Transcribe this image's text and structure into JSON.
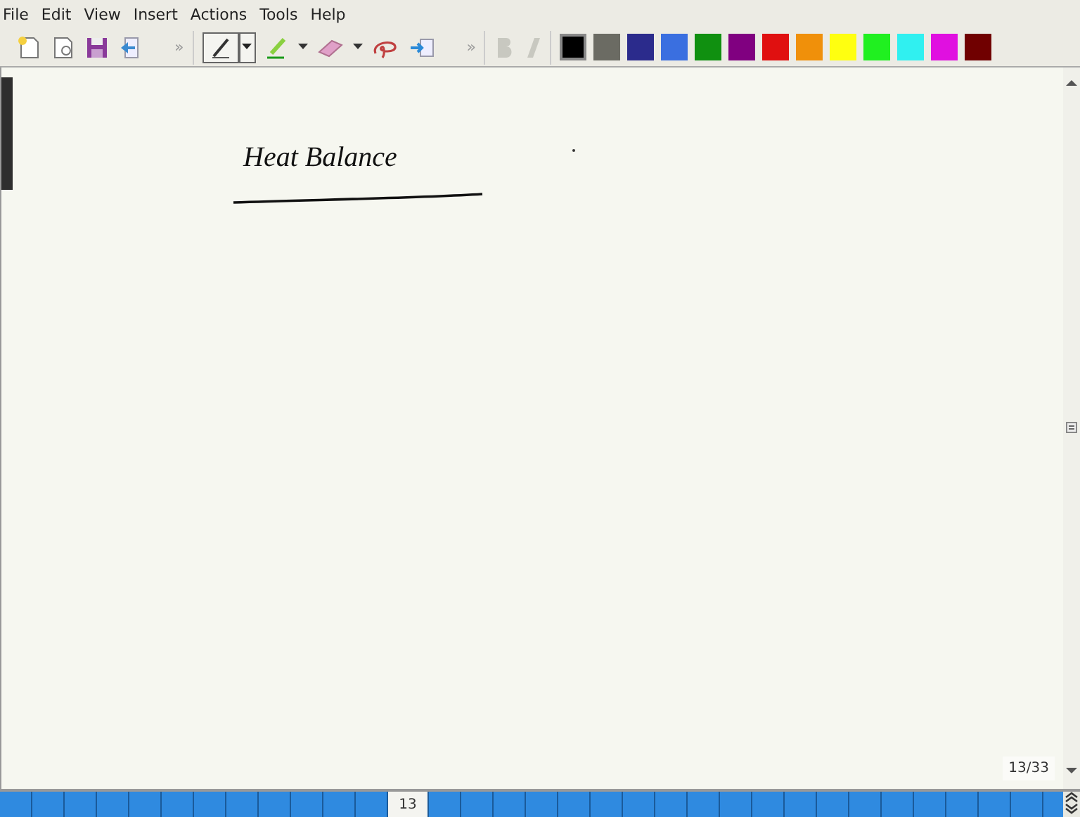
{
  "menu": [
    "File",
    "Edit",
    "View",
    "Insert",
    "Actions",
    "Tools",
    "Help"
  ],
  "toolbar": {
    "overflow_left": "»",
    "overflow_right": "»",
    "pen_selected": true,
    "bold_disabled": true,
    "italic_disabled": true
  },
  "palette": [
    {
      "color": "#000000",
      "selected": true
    },
    {
      "color": "#6b6b63",
      "selected": false
    },
    {
      "color": "#2b2b8c",
      "selected": false
    },
    {
      "color": "#3a6fe0",
      "selected": false
    },
    {
      "color": "#109010",
      "selected": false
    },
    {
      "color": "#800080",
      "selected": false
    },
    {
      "color": "#e01010",
      "selected": false
    },
    {
      "color": "#f0900a",
      "selected": false
    },
    {
      "color": "#ffff10",
      "selected": false
    },
    {
      "color": "#20f020",
      "selected": false
    },
    {
      "color": "#30f0f0",
      "selected": false
    },
    {
      "color": "#e010e0",
      "selected": false
    },
    {
      "color": "#700000",
      "selected": false
    }
  ],
  "note": {
    "heading": "Heat Balance",
    "page_counter": "13/33"
  },
  "page_tabs": [
    {
      "selected": false
    },
    {
      "selected": false
    },
    {
      "selected": false
    },
    {
      "selected": false
    },
    {
      "selected": false
    },
    {
      "selected": false
    },
    {
      "selected": false
    },
    {
      "selected": false
    },
    {
      "selected": false
    },
    {
      "selected": false
    },
    {
      "selected": false
    },
    {
      "selected": false
    },
    {
      "label": "13",
      "selected": true
    },
    {
      "selected": false
    },
    {
      "selected": false
    },
    {
      "selected": false
    },
    {
      "selected": false
    },
    {
      "selected": false
    },
    {
      "selected": false
    },
    {
      "selected": false
    },
    {
      "selected": false
    },
    {
      "selected": false
    },
    {
      "selected": false
    },
    {
      "selected": false
    },
    {
      "selected": false
    },
    {
      "selected": false
    },
    {
      "selected": false
    },
    {
      "selected": false
    },
    {
      "selected": false
    },
    {
      "selected": false
    },
    {
      "selected": false
    },
    {
      "selected": false
    },
    {
      "selected": false
    }
  ]
}
